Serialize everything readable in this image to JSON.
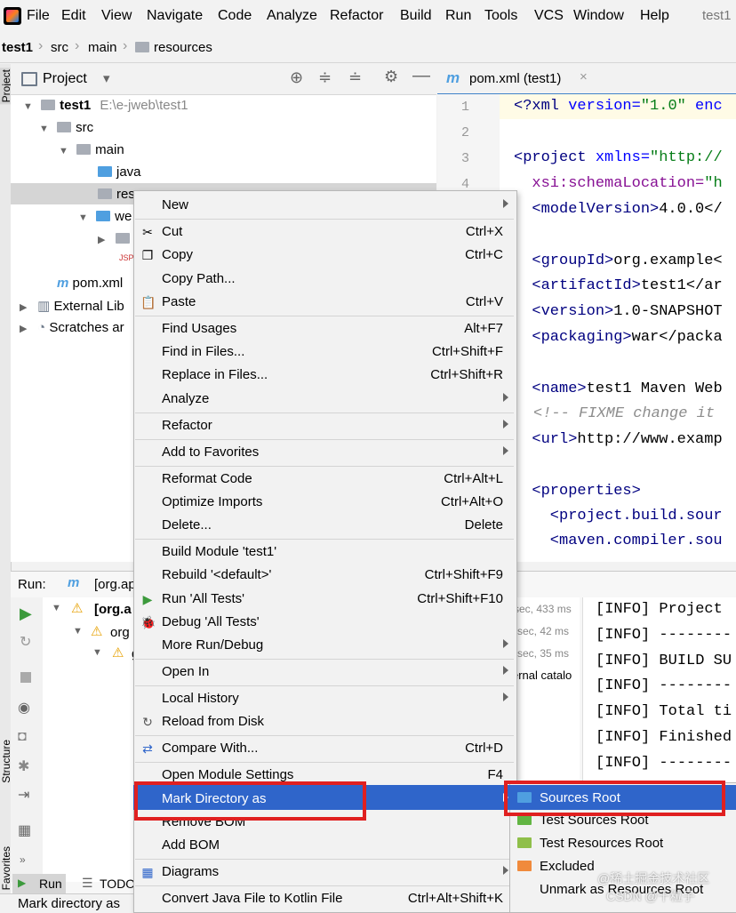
{
  "menubar": {
    "items": [
      "File",
      "Edit",
      "View",
      "Navigate",
      "Code",
      "Analyze",
      "Refactor",
      "Build",
      "Run",
      "Tools",
      "VCS",
      "Window",
      "Help"
    ],
    "project_title": "test1"
  },
  "breadcrumb": [
    "test1",
    "src",
    "main",
    "resources"
  ],
  "left_strip": {
    "project_label": "Project",
    "structure_label": "Structure",
    "favorites_label": "Favorites"
  },
  "project_panel": {
    "title": "Project",
    "tree": {
      "root": "test1",
      "root_path": "E:\\e-jweb\\test1",
      "src": "src",
      "main": "main",
      "java": "java",
      "resources": "resources",
      "webapp": "we",
      "pom": "pom.xml",
      "external_libs": "External Lib",
      "scratches": "Scratches ar"
    }
  },
  "editor": {
    "tab": "pom.xml (test1)",
    "line_numbers": [
      "1",
      "2",
      "3",
      "4"
    ],
    "lines": [
      {
        "a": "<?xml ",
        "b": "version=",
        "c": "\"1.0\"",
        "d": " enc"
      },
      {
        "a": "",
        "b": "",
        "c": "",
        "d": ""
      },
      {
        "a": "<project ",
        "b": "xmlns=",
        "c": "\"http://",
        "d": ""
      },
      {
        "a": "  ",
        "b": "xsi:schemaLocation=",
        "c": "\"h",
        "d": ""
      },
      {
        "a": "  <modelVersion>",
        "b": "",
        "c": "",
        "d": "4.0.0</"
      },
      {
        "a": "",
        "b": "",
        "c": "",
        "d": ""
      },
      {
        "a": "  <groupId>",
        "b": "",
        "c": "",
        "d": "org.example<"
      },
      {
        "a": "  <artifactId>",
        "b": "",
        "c": "",
        "d": "test1</ar"
      },
      {
        "a": "  <version>",
        "b": "",
        "c": "",
        "d": "1.0-SNAPSHOT"
      },
      {
        "a": "  <packaging>",
        "b": "",
        "c": "",
        "d": "war</packa"
      },
      {
        "a": "",
        "b": "",
        "c": "",
        "d": ""
      },
      {
        "a": "  <name>",
        "b": "",
        "c": "",
        "d": "test1 Maven Web"
      },
      {
        "a": "",
        "b": "",
        "c": "",
        "d": ""
      },
      {
        "a": "  <url>",
        "b": "",
        "c": "",
        "d": "http://www.examp"
      },
      {
        "a": "",
        "b": "",
        "c": "",
        "d": ""
      },
      {
        "a": "  <properties>",
        "b": "",
        "c": "",
        "d": ""
      },
      {
        "a": "    <project.build.sour",
        "b": "",
        "c": "",
        "d": ""
      }
    ],
    "comment_line": "<!-- FIXME change it",
    "last_line": "    <maven.compiler.sou"
  },
  "run_panel": {
    "label": "Run:",
    "tab": "[org.ap",
    "tree": [
      "[org.a",
      "org",
      "g"
    ],
    "timings": [
      "sec, 433 ms",
      "sec, 42 ms",
      "sec, 35 ms",
      "ernal catalo"
    ],
    "console": [
      "[INFO] Project",
      "[INFO] --------",
      "[INFO] BUILD SU",
      "[INFO] --------",
      "[INFO] Total ti",
      "[INFO] Finished",
      "[INFO] --------"
    ],
    "bottom_tabs": {
      "run": "Run",
      "todo": "TODO"
    }
  },
  "status": "Mark directory as",
  "context_menu": {
    "items": [
      {
        "label": "New",
        "shortcut": "",
        "submenu": true
      },
      {
        "label": "Cut",
        "shortcut": "Ctrl+X",
        "icon": "✂"
      },
      {
        "label": "Copy",
        "shortcut": "Ctrl+C",
        "icon": "❐"
      },
      {
        "label": "Copy Path...",
        "shortcut": ""
      },
      {
        "label": "Paste",
        "shortcut": "Ctrl+V",
        "icon": "📋"
      },
      {
        "label": "Find Usages",
        "shortcut": "Alt+F7"
      },
      {
        "label": "Find in Files...",
        "shortcut": "Ctrl+Shift+F"
      },
      {
        "label": "Replace in Files...",
        "shortcut": "Ctrl+Shift+R"
      },
      {
        "label": "Analyze",
        "shortcut": "",
        "submenu": true
      },
      {
        "label": "Refactor",
        "shortcut": "",
        "submenu": true
      },
      {
        "label": "Add to Favorites",
        "shortcut": "",
        "submenu": true
      },
      {
        "label": "Reformat Code",
        "shortcut": "Ctrl+Alt+L"
      },
      {
        "label": "Optimize Imports",
        "shortcut": "Ctrl+Alt+O"
      },
      {
        "label": "Delete...",
        "shortcut": "Delete"
      },
      {
        "label": "Build Module 'test1'",
        "shortcut": ""
      },
      {
        "label": "Rebuild '<default>'",
        "shortcut": "Ctrl+Shift+F9"
      },
      {
        "label": "Run 'All Tests'",
        "shortcut": "Ctrl+Shift+F10",
        "icon": "▶"
      },
      {
        "label": "Debug 'All Tests'",
        "shortcut": "",
        "icon": "🐞"
      },
      {
        "label": "More Run/Debug",
        "shortcut": "",
        "submenu": true
      },
      {
        "label": "Open In",
        "shortcut": "",
        "submenu": true
      },
      {
        "label": "Local History",
        "shortcut": "",
        "submenu": true
      },
      {
        "label": "Reload from Disk",
        "shortcut": "",
        "icon": "↻"
      },
      {
        "label": "Compare With...",
        "shortcut": "Ctrl+D",
        "icon": "⇄"
      },
      {
        "label": "Open Module Settings",
        "shortcut": "F4"
      },
      {
        "label": "Mark Directory as",
        "shortcut": "",
        "submenu": true
      },
      {
        "label": "Remove BOM",
        "shortcut": ""
      },
      {
        "label": "Add BOM",
        "shortcut": ""
      },
      {
        "label": "Diagrams",
        "shortcut": "",
        "submenu": true,
        "icon": "▦"
      },
      {
        "label": "Convert Java File to Kotlin File",
        "shortcut": "Ctrl+Alt+Shift+K"
      }
    ]
  },
  "submenu": {
    "items": [
      {
        "label": "Sources Root",
        "color": "#4f9fe0"
      },
      {
        "label": "Test Sources Root",
        "color": "#62b543"
      },
      {
        "label": "Test Resources Root",
        "color": "#8fbf4a"
      },
      {
        "label": "Excluded",
        "color": "#f08a3c"
      },
      {
        "label": "Unmark as Resources Root",
        "color": ""
      }
    ]
  },
  "watermark": {
    "line1": "@稀土掘金技术社区",
    "line2": "CSDN @千粒子"
  },
  "colors": {
    "highlight": "#2f65ca",
    "red_box": "#e02020"
  }
}
